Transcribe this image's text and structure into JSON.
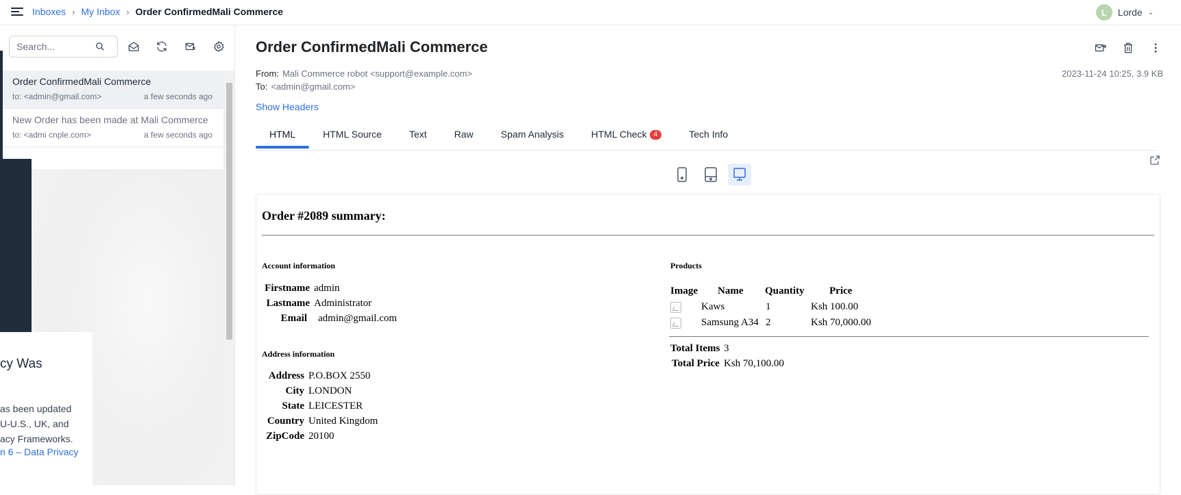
{
  "header": {
    "breadcrumbs": [
      "Inboxes",
      "My Inbox",
      "Order ConfirmedMali Commerce"
    ],
    "crumb_sep": "›",
    "user": {
      "initial": "L",
      "name": "Lorde",
      "caret": "⌄"
    }
  },
  "sidebar": {
    "search_placeholder": "Search...",
    "messages": [
      {
        "subject": "Order ConfirmedMali Commerce",
        "to": "to: <admin@gmail.com>",
        "time": "a few seconds ago"
      },
      {
        "subject": "New Order has been made at Mali Commerce",
        "to": "to: <admi     cnple.com>",
        "time": "a few seconds ago"
      }
    ],
    "overlay": {
      "heading": "cy Was",
      "text": "as been updated\nU-U.S., UK, and\nacy Frameworks.",
      "link": "n 6 – Data Privacy"
    }
  },
  "message": {
    "subject": "Order ConfirmedMali Commerce",
    "from_label": "From:",
    "from": "Mali Commerce robot <support@example.com>",
    "to_label": "To:",
    "to": "<admin@gmail.com>",
    "date_size": "2023-11-24 10:25, 3.9 KB",
    "show_headers": "Show Headers",
    "tabs": [
      {
        "label": "HTML"
      },
      {
        "label": "HTML Source"
      },
      {
        "label": "Text"
      },
      {
        "label": "Raw"
      },
      {
        "label": "Spam Analysis"
      },
      {
        "label": "HTML Check",
        "badge": "4"
      },
      {
        "label": "Tech Info"
      }
    ]
  },
  "email": {
    "title": "Order #2089 summary:",
    "account_heading": "Account information",
    "account": [
      {
        "key": "Firstname",
        "value": "admin"
      },
      {
        "key": "Lastname",
        "value": "Administrator"
      },
      {
        "key": "Email",
        "value": "admin@gmail.com"
      }
    ],
    "address_heading": "Address information",
    "address": [
      {
        "key": "Address",
        "value": "P.O.BOX 2550"
      },
      {
        "key": "City",
        "value": "LONDON"
      },
      {
        "key": "State",
        "value": "LEICESTER"
      },
      {
        "key": "Country",
        "value": "United Kingdom"
      },
      {
        "key": "ZipCode",
        "value": "20100"
      }
    ],
    "products_heading": "Products",
    "product_columns": [
      "Image",
      "Name",
      "Quantity",
      "Price"
    ],
    "products": [
      {
        "name": "Kaws",
        "quantity": "1",
        "price": "Ksh 100.00"
      },
      {
        "name": "Samsung A34",
        "quantity": "2",
        "price": "Ksh 70,000.00"
      }
    ],
    "totals": [
      {
        "key": "Total Items",
        "value": "3"
      },
      {
        "key": "Total Price",
        "value": "Ksh 70,100.00"
      }
    ]
  }
}
